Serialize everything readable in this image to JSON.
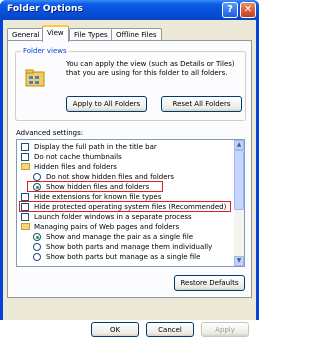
{
  "window": {
    "title": "Folder Options"
  },
  "title_buttons": {
    "help": "?",
    "close": "✕"
  },
  "tabs": [
    "General",
    "View",
    "File Types",
    "Offline Files"
  ],
  "folder_views": {
    "legend": "Folder views",
    "description": "You can apply the view (such as Details or Tiles) that you are using for this folder to all folders.",
    "apply_button": "Apply to All Folders",
    "reset_button": "Reset All Folders"
  },
  "advanced": {
    "label": "Advanced settings:",
    "items": [
      {
        "kind": "checkbox",
        "text": "Display the full path in the title bar"
      },
      {
        "kind": "checkbox",
        "text": "Do not cache thumbnails"
      },
      {
        "kind": "folder",
        "text": "Hidden files and folders"
      },
      {
        "kind": "radio",
        "text": "Do not show hidden files and folders"
      },
      {
        "kind": "radio",
        "text": "Show hidden files and folders",
        "selected": true
      },
      {
        "kind": "checkbox",
        "text": "Hide extensions for known file types"
      },
      {
        "kind": "checkbox",
        "text": "Hide protected operating system files (Recommended)"
      },
      {
        "kind": "checkbox",
        "text": "Launch folder windows in a separate process"
      },
      {
        "kind": "folder",
        "text": "Managing pairs of Web pages and folders"
      },
      {
        "kind": "radio",
        "text": "Show and manage the pair as a single file",
        "selected": true
      },
      {
        "kind": "radio",
        "text": "Show both parts and manage them individually"
      },
      {
        "kind": "radio",
        "text": "Show both parts but manage as a single file"
      }
    ],
    "restore_button": "Restore Defaults"
  },
  "buttons": {
    "ok": "OK",
    "cancel": "Cancel",
    "apply": "Apply"
  },
  "colors": {
    "title_bar": "#0b5ce6",
    "accent": "#0046d5",
    "highlight_box": "#e02020",
    "face": "#ece9d8"
  }
}
